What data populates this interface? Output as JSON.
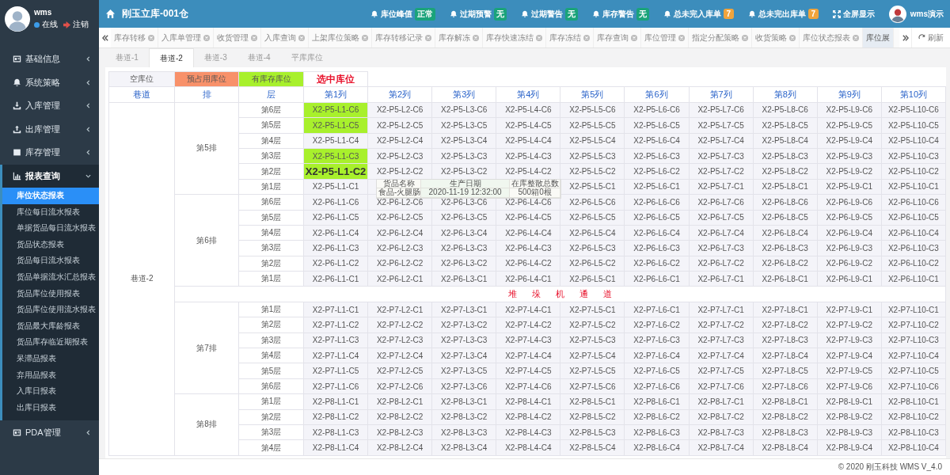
{
  "sidebar": {
    "user": {
      "name": "wms",
      "status": "在线",
      "logout": "注销"
    },
    "menu": [
      {
        "label": "基础信息",
        "expanded": false
      },
      {
        "label": "系统策略",
        "expanded": false
      },
      {
        "label": "入库管理",
        "expanded": false
      },
      {
        "label": "出库管理",
        "expanded": false
      },
      {
        "label": "库存管理",
        "expanded": false
      },
      {
        "label": "报表查询",
        "expanded": true,
        "children": [
          {
            "label": "库位状态报表",
            "selected": true
          },
          {
            "label": "库位每日流水报表",
            "selected": false
          },
          {
            "label": "单据货品每日流水报表",
            "selected": false
          },
          {
            "label": "货品状态报表",
            "selected": false
          },
          {
            "label": "货品每日流水报表",
            "selected": false
          },
          {
            "label": "货品单据流水汇总报表",
            "selected": false
          },
          {
            "label": "货品库位使用报表",
            "selected": false
          },
          {
            "label": "货品库位使用流水报表",
            "selected": false
          },
          {
            "label": "货品最大库龄报表",
            "selected": false
          },
          {
            "label": "货品库存临近期报表",
            "selected": false
          },
          {
            "label": "呆滞品报表",
            "selected": false
          },
          {
            "label": "弃用品报表",
            "selected": false
          },
          {
            "label": "入库日报表",
            "selected": false
          },
          {
            "label": "出库日报表",
            "selected": false
          }
        ]
      },
      {
        "label": "PDA管理",
        "expanded": false
      }
    ]
  },
  "header": {
    "title": "刚玉立库-001仓",
    "alerts": [
      {
        "label": "库位峰值",
        "badge": "正常",
        "color": "#1aa37a"
      },
      {
        "label": "过期预警",
        "badge": "无",
        "color": "#1aa37a"
      },
      {
        "label": "过期警告",
        "badge": "无",
        "color": "#1aa37a"
      },
      {
        "label": "库存警告",
        "badge": "无",
        "color": "#1aa37a"
      },
      {
        "label": "总未完入库单",
        "badge": "7",
        "color": "#f0a43c"
      },
      {
        "label": "总未完出库单",
        "badge": "7",
        "color": "#f0a43c"
      }
    ],
    "fullscreen": "全屏显示",
    "user": "wms演示"
  },
  "tabs": [
    {
      "label": "库存转移",
      "selected": false,
      "closable": true
    },
    {
      "label": "入库单管理",
      "selected": false,
      "closable": true
    },
    {
      "label": "收货管理",
      "selected": false,
      "closable": true
    },
    {
      "label": "入库查询",
      "selected": false,
      "closable": true
    },
    {
      "label": "上架库位策略",
      "selected": false,
      "closable": true
    },
    {
      "label": "库存转移记录",
      "selected": false,
      "closable": true
    },
    {
      "label": "库存解冻",
      "selected": false,
      "closable": true
    },
    {
      "label": "库存快速冻结",
      "selected": false,
      "closable": true
    },
    {
      "label": "库存冻结",
      "selected": false,
      "closable": true
    },
    {
      "label": "库存查询",
      "selected": false,
      "closable": true
    },
    {
      "label": "库位管理",
      "selected": false,
      "closable": true
    },
    {
      "label": "指定分配策略",
      "selected": false,
      "closable": true
    },
    {
      "label": "收货策略",
      "selected": false,
      "closable": true
    },
    {
      "label": "库位状态报表",
      "selected": false,
      "closable": true
    },
    {
      "label": "库位展",
      "selected": true,
      "closable": false
    }
  ],
  "refresh": "刷新",
  "subtabs": [
    {
      "label": "巷道-1",
      "selected": false
    },
    {
      "label": "巷道-2",
      "selected": true
    },
    {
      "label": "巷道-3",
      "selected": false
    },
    {
      "label": "巷道-4",
      "selected": false
    },
    {
      "label": "平库库位",
      "selected": false
    }
  ],
  "grid": {
    "legend": [
      {
        "label": "空库位",
        "kind": "empty"
      },
      {
        "label": "预占用库位",
        "kind": "reserved"
      },
      {
        "label": "有库存库位",
        "kind": "stocked"
      },
      {
        "label": "选中库位",
        "kind": "selected"
      }
    ],
    "columns": [
      "巷道",
      "排",
      "层",
      "第1列",
      "第2列",
      "第3列",
      "第4列",
      "第5列",
      "第6列",
      "第7列",
      "第8列",
      "第9列",
      "第10列"
    ],
    "aisle": "巷道-2",
    "blocks": [
      {
        "kind": "rack",
        "row": "第5排",
        "layers": [
          {
            "layer": "第6层",
            "cells": [
              {
                "code": "X2-P5-L1-C6",
                "stocked": true,
                "selected": false
              },
              {
                "code": "X2-P5-L2-C6",
                "stocked": false,
                "selected": false
              },
              {
                "code": "X2-P5-L3-C6",
                "stocked": false,
                "selected": false
              },
              {
                "code": "X2-P5-L4-C6",
                "stocked": false,
                "selected": false
              },
              {
                "code": "X2-P5-L5-C6",
                "stocked": false,
                "selected": false
              },
              {
                "code": "X2-P5-L6-C6",
                "stocked": false,
                "selected": false
              },
              {
                "code": "X2-P5-L7-C6",
                "stocked": false,
                "selected": false
              },
              {
                "code": "X2-P5-L8-C6",
                "stocked": false,
                "selected": false
              },
              {
                "code": "X2-P5-L9-C6",
                "stocked": false,
                "selected": false
              },
              {
                "code": "X2-P5-L10-C6",
                "stocked": false,
                "selected": false
              }
            ]
          },
          {
            "layer": "第5层",
            "cells": [
              {
                "code": "X2-P5-L1-C5",
                "stocked": true,
                "selected": false
              },
              {
                "code": "X2-P5-L2-C5",
                "stocked": false,
                "selected": false
              },
              {
                "code": "X2-P5-L3-C5",
                "stocked": false,
                "selected": false
              },
              {
                "code": "X2-P5-L4-C5",
                "stocked": false,
                "selected": false
              },
              {
                "code": "X2-P5-L5-C5",
                "stocked": false,
                "selected": false
              },
              {
                "code": "X2-P5-L6-C5",
                "stocked": false,
                "selected": false
              },
              {
                "code": "X2-P5-L7-C5",
                "stocked": false,
                "selected": false
              },
              {
                "code": "X2-P5-L8-C5",
                "stocked": false,
                "selected": false
              },
              {
                "code": "X2-P5-L9-C5",
                "stocked": false,
                "selected": false
              },
              {
                "code": "X2-P5-L10-C5",
                "stocked": false,
                "selected": false
              }
            ]
          },
          {
            "layer": "第4层",
            "cells": [
              {
                "code": "X2-P5-L1-C4",
                "stocked": false,
                "selected": false
              },
              {
                "code": "X2-P5-L2-C4",
                "stocked": false,
                "selected": false
              },
              {
                "code": "X2-P5-L3-C4",
                "stocked": false,
                "selected": false
              },
              {
                "code": "X2-P5-L4-C4",
                "stocked": false,
                "selected": false
              },
              {
                "code": "X2-P5-L5-C4",
                "stocked": false,
                "selected": false
              },
              {
                "code": "X2-P5-L6-C4",
                "stocked": false,
                "selected": false
              },
              {
                "code": "X2-P5-L7-C4",
                "stocked": false,
                "selected": false
              },
              {
                "code": "X2-P5-L8-C4",
                "stocked": false,
                "selected": false
              },
              {
                "code": "X2-P5-L9-C4",
                "stocked": false,
                "selected": false
              },
              {
                "code": "X2-P5-L10-C4",
                "stocked": false,
                "selected": false
              }
            ]
          },
          {
            "layer": "第3层",
            "cells": [
              {
                "code": "X2-P5-L1-C3",
                "stocked": true,
                "selected": false
              },
              {
                "code": "X2-P5-L2-C3",
                "stocked": false,
                "selected": false
              },
              {
                "code": "X2-P5-L3-C3",
                "stocked": false,
                "selected": false
              },
              {
                "code": "X2-P5-L4-C3",
                "stocked": false,
                "selected": false
              },
              {
                "code": "X2-P5-L5-C3",
                "stocked": false,
                "selected": false
              },
              {
                "code": "X2-P5-L6-C3",
                "stocked": false,
                "selected": false
              },
              {
                "code": "X2-P5-L7-C3",
                "stocked": false,
                "selected": false
              },
              {
                "code": "X2-P5-L8-C3",
                "stocked": false,
                "selected": false
              },
              {
                "code": "X2-P5-L9-C3",
                "stocked": false,
                "selected": false
              },
              {
                "code": "X2-P5-L10-C3",
                "stocked": false,
                "selected": false
              }
            ]
          },
          {
            "layer": "第2层",
            "cells": [
              {
                "code": "X2-P5-L1-C2",
                "stocked": true,
                "selected": true
              },
              {
                "code": "X2-P5-L2-C2",
                "stocked": false,
                "selected": false
              },
              {
                "code": "X2-P5-L3-C2",
                "stocked": false,
                "selected": false
              },
              {
                "code": "X2-P5-L4-C2",
                "stocked": false,
                "selected": false
              },
              {
                "code": "X2-P5-L5-C2",
                "stocked": false,
                "selected": false
              },
              {
                "code": "X2-P5-L6-C2",
                "stocked": false,
                "selected": false
              },
              {
                "code": "X2-P5-L7-C2",
                "stocked": false,
                "selected": false
              },
              {
                "code": "X2-P5-L8-C2",
                "stocked": false,
                "selected": false
              },
              {
                "code": "X2-P5-L9-C2",
                "stocked": false,
                "selected": false
              },
              {
                "code": "X2-P5-L10-C2",
                "stocked": false,
                "selected": false
              }
            ]
          },
          {
            "layer": "第1层",
            "tooltip": {
              "headers": [
                "货品名称",
                "生产日期",
                "在库整散总数"
              ],
              "values": [
                "食品-火腿肠",
                "2020-11-19 12:32:00",
                "500箱0根"
              ]
            },
            "cells": [
              {
                "code": "X2-P5-L1-C1",
                "stocked": false,
                "selected": false
              },
              {},
              {},
              {},
              {
                "code": "X2-P5-L5-C1",
                "stocked": false,
                "selected": false
              },
              {
                "code": "X2-P5-L6-C1",
                "stocked": false,
                "selected": false
              },
              {
                "code": "X2-P5-L7-C1",
                "stocked": false,
                "selected": false
              },
              {
                "code": "X2-P5-L8-C1",
                "stocked": false,
                "selected": false
              },
              {
                "code": "X2-P5-L9-C1",
                "stocked": false,
                "selected": false
              },
              {
                "code": "X2-P5-L10-C1",
                "stocked": false,
                "selected": false
              }
            ]
          }
        ]
      },
      {
        "kind": "rack",
        "row": "第6排",
        "layers": [
          {
            "layer": "第6层",
            "cells": [
              {
                "code": "X2-P6-L1-C6",
                "stocked": false,
                "selected": false
              },
              {
                "code": "X2-P6-L2-C6",
                "stocked": false,
                "selected": false
              },
              {
                "code": "X2-P6-L3-C6",
                "stocked": false,
                "selected": false
              },
              {
                "code": "X2-P6-L4-C6",
                "stocked": false,
                "selected": false
              },
              {
                "code": "X2-P6-L5-C6",
                "stocked": false,
                "selected": false
              },
              {
                "code": "X2-P6-L6-C6",
                "stocked": false,
                "selected": false
              },
              {
                "code": "X2-P6-L7-C6",
                "stocked": false,
                "selected": false
              },
              {
                "code": "X2-P6-L8-C6",
                "stocked": false,
                "selected": false
              },
              {
                "code": "X2-P6-L9-C6",
                "stocked": false,
                "selected": false
              },
              {
                "code": "X2-P6-L10-C6",
                "stocked": false,
                "selected": false
              }
            ]
          },
          {
            "layer": "第5层",
            "cells": [
              {
                "code": "X2-P6-L1-C5",
                "stocked": false,
                "selected": false
              },
              {
                "code": "X2-P6-L2-C5",
                "stocked": false,
                "selected": false
              },
              {
                "code": "X2-P6-L3-C5",
                "stocked": false,
                "selected": false
              },
              {
                "code": "X2-P6-L4-C5",
                "stocked": false,
                "selected": false
              },
              {
                "code": "X2-P6-L5-C5",
                "stocked": false,
                "selected": false
              },
              {
                "code": "X2-P6-L6-C5",
                "stocked": false,
                "selected": false
              },
              {
                "code": "X2-P6-L7-C5",
                "stocked": false,
                "selected": false
              },
              {
                "code": "X2-P6-L8-C5",
                "stocked": false,
                "selected": false
              },
              {
                "code": "X2-P6-L9-C5",
                "stocked": false,
                "selected": false
              },
              {
                "code": "X2-P6-L10-C5",
                "stocked": false,
                "selected": false
              }
            ]
          },
          {
            "layer": "第4层",
            "cells": [
              {
                "code": "X2-P6-L1-C4",
                "stocked": false,
                "selected": false
              },
              {
                "code": "X2-P6-L2-C4",
                "stocked": false,
                "selected": false
              },
              {
                "code": "X2-P6-L3-C4",
                "stocked": false,
                "selected": false
              },
              {
                "code": "X2-P6-L4-C4",
                "stocked": false,
                "selected": false
              },
              {
                "code": "X2-P6-L5-C4",
                "stocked": false,
                "selected": false
              },
              {
                "code": "X2-P6-L6-C4",
                "stocked": false,
                "selected": false
              },
              {
                "code": "X2-P6-L7-C4",
                "stocked": false,
                "selected": false
              },
              {
                "code": "X2-P6-L8-C4",
                "stocked": false,
                "selected": false
              },
              {
                "code": "X2-P6-L9-C4",
                "stocked": false,
                "selected": false
              },
              {
                "code": "X2-P6-L10-C4",
                "stocked": false,
                "selected": false
              }
            ]
          },
          {
            "layer": "第3层",
            "cells": [
              {
                "code": "X2-P6-L1-C3",
                "stocked": false,
                "selected": false
              },
              {
                "code": "X2-P6-L2-C3",
                "stocked": false,
                "selected": false
              },
              {
                "code": "X2-P6-L3-C3",
                "stocked": false,
                "selected": false
              },
              {
                "code": "X2-P6-L4-C3",
                "stocked": false,
                "selected": false
              },
              {
                "code": "X2-P6-L5-C3",
                "stocked": false,
                "selected": false
              },
              {
                "code": "X2-P6-L6-C3",
                "stocked": false,
                "selected": false
              },
              {
                "code": "X2-P6-L7-C3",
                "stocked": false,
                "selected": false
              },
              {
                "code": "X2-P6-L8-C3",
                "stocked": false,
                "selected": false
              },
              {
                "code": "X2-P6-L9-C3",
                "stocked": false,
                "selected": false
              },
              {
                "code": "X2-P6-L10-C3",
                "stocked": false,
                "selected": false
              }
            ]
          },
          {
            "layer": "第2层",
            "cells": [
              {
                "code": "X2-P6-L1-C2",
                "stocked": false,
                "selected": false
              },
              {
                "code": "X2-P6-L2-C2",
                "stocked": false,
                "selected": false
              },
              {
                "code": "X2-P6-L3-C2",
                "stocked": false,
                "selected": false
              },
              {
                "code": "X2-P6-L4-C2",
                "stocked": false,
                "selected": false
              },
              {
                "code": "X2-P6-L5-C2",
                "stocked": false,
                "selected": false
              },
              {
                "code": "X2-P6-L6-C2",
                "stocked": false,
                "selected": false
              },
              {
                "code": "X2-P6-L7-C2",
                "stocked": false,
                "selected": false
              },
              {
                "code": "X2-P6-L8-C2",
                "stocked": false,
                "selected": false
              },
              {
                "code": "X2-P6-L9-C2",
                "stocked": false,
                "selected": false
              },
              {
                "code": "X2-P6-L10-C2",
                "stocked": false,
                "selected": false
              }
            ]
          },
          {
            "layer": "第1层",
            "cells": [
              {
                "code": "X2-P6-L1-C1",
                "stocked": false,
                "selected": false
              },
              {
                "code": "X2-P6-L2-C1",
                "stocked": false,
                "selected": false
              },
              {
                "code": "X2-P6-L3-C1",
                "stocked": false,
                "selected": false
              },
              {
                "code": "X2-P6-L4-C1",
                "stocked": false,
                "selected": false
              },
              {
                "code": "X2-P6-L5-C1",
                "stocked": false,
                "selected": false
              },
              {
                "code": "X2-P6-L6-C1",
                "stocked": false,
                "selected": false
              },
              {
                "code": "X2-P6-L7-C1",
                "stocked": false,
                "selected": false
              },
              {
                "code": "X2-P6-L8-C1",
                "stocked": false,
                "selected": false
              },
              {
                "code": "X2-P6-L9-C1",
                "stocked": false,
                "selected": false
              },
              {
                "code": "X2-P6-L10-C1",
                "stocked": false,
                "selected": false
              }
            ]
          }
        ]
      },
      {
        "kind": "passage",
        "label": "堆 垛 机 通 道"
      },
      {
        "kind": "rack",
        "row": "第7排",
        "layers": [
          {
            "layer": "第1层",
            "cells": [
              {
                "code": "X2-P7-L1-C1",
                "stocked": false,
                "selected": false
              },
              {
                "code": "X2-P7-L2-C1",
                "stocked": false,
                "selected": false
              },
              {
                "code": "X2-P7-L3-C1",
                "stocked": false,
                "selected": false
              },
              {
                "code": "X2-P7-L4-C1",
                "stocked": false,
                "selected": false
              },
              {
                "code": "X2-P7-L5-C1",
                "stocked": false,
                "selected": false
              },
              {
                "code": "X2-P7-L6-C1",
                "stocked": false,
                "selected": false
              },
              {
                "code": "X2-P7-L7-C1",
                "stocked": false,
                "selected": false
              },
              {
                "code": "X2-P7-L8-C1",
                "stocked": false,
                "selected": false
              },
              {
                "code": "X2-P7-L9-C1",
                "stocked": false,
                "selected": false
              },
              {
                "code": "X2-P7-L10-C1",
                "stocked": false,
                "selected": false
              }
            ]
          },
          {
            "layer": "第2层",
            "cells": [
              {
                "code": "X2-P7-L1-C2",
                "stocked": false,
                "selected": false
              },
              {
                "code": "X2-P7-L2-C2",
                "stocked": false,
                "selected": false
              },
              {
                "code": "X2-P7-L3-C2",
                "stocked": false,
                "selected": false
              },
              {
                "code": "X2-P7-L4-C2",
                "stocked": false,
                "selected": false
              },
              {
                "code": "X2-P7-L5-C2",
                "stocked": false,
                "selected": false
              },
              {
                "code": "X2-P7-L6-C2",
                "stocked": false,
                "selected": false
              },
              {
                "code": "X2-P7-L7-C2",
                "stocked": false,
                "selected": false
              },
              {
                "code": "X2-P7-L8-C2",
                "stocked": false,
                "selected": false
              },
              {
                "code": "X2-P7-L9-C2",
                "stocked": false,
                "selected": false
              },
              {
                "code": "X2-P7-L10-C2",
                "stocked": false,
                "selected": false
              }
            ]
          },
          {
            "layer": "第3层",
            "cells": [
              {
                "code": "X2-P7-L1-C3",
                "stocked": false,
                "selected": false
              },
              {
                "code": "X2-P7-L2-C3",
                "stocked": false,
                "selected": false
              },
              {
                "code": "X2-P7-L3-C3",
                "stocked": false,
                "selected": false
              },
              {
                "code": "X2-P7-L4-C3",
                "stocked": false,
                "selected": false
              },
              {
                "code": "X2-P7-L5-C3",
                "stocked": false,
                "selected": false
              },
              {
                "code": "X2-P7-L6-C3",
                "stocked": false,
                "selected": false
              },
              {
                "code": "X2-P7-L7-C3",
                "stocked": false,
                "selected": false
              },
              {
                "code": "X2-P7-L8-C3",
                "stocked": false,
                "selected": false
              },
              {
                "code": "X2-P7-L9-C3",
                "stocked": false,
                "selected": false
              },
              {
                "code": "X2-P7-L10-C3",
                "stocked": false,
                "selected": false
              }
            ]
          },
          {
            "layer": "第4层",
            "cells": [
              {
                "code": "X2-P7-L1-C4",
                "stocked": false,
                "selected": false
              },
              {
                "code": "X2-P7-L2-C4",
                "stocked": false,
                "selected": false
              },
              {
                "code": "X2-P7-L3-C4",
                "stocked": false,
                "selected": false
              },
              {
                "code": "X2-P7-L4-C4",
                "stocked": false,
                "selected": false
              },
              {
                "code": "X2-P7-L5-C4",
                "stocked": false,
                "selected": false
              },
              {
                "code": "X2-P7-L6-C4",
                "stocked": false,
                "selected": false
              },
              {
                "code": "X2-P7-L7-C4",
                "stocked": false,
                "selected": false
              },
              {
                "code": "X2-P7-L8-C4",
                "stocked": false,
                "selected": false
              },
              {
                "code": "X2-P7-L9-C4",
                "stocked": false,
                "selected": false
              },
              {
                "code": "X2-P7-L10-C4",
                "stocked": false,
                "selected": false
              }
            ]
          },
          {
            "layer": "第5层",
            "cells": [
              {
                "code": "X2-P7-L1-C5",
                "stocked": false,
                "selected": false
              },
              {
                "code": "X2-P7-L2-C5",
                "stocked": false,
                "selected": false
              },
              {
                "code": "X2-P7-L3-C5",
                "stocked": false,
                "selected": false
              },
              {
                "code": "X2-P7-L4-C5",
                "stocked": false,
                "selected": false
              },
              {
                "code": "X2-P7-L5-C5",
                "stocked": false,
                "selected": false
              },
              {
                "code": "X2-P7-L6-C5",
                "stocked": false,
                "selected": false
              },
              {
                "code": "X2-P7-L7-C5",
                "stocked": false,
                "selected": false
              },
              {
                "code": "X2-P7-L8-C5",
                "stocked": false,
                "selected": false
              },
              {
                "code": "X2-P7-L9-C5",
                "stocked": false,
                "selected": false
              },
              {
                "code": "X2-P7-L10-C5",
                "stocked": false,
                "selected": false
              }
            ]
          },
          {
            "layer": "第6层",
            "cells": [
              {
                "code": "X2-P7-L1-C6",
                "stocked": false,
                "selected": false
              },
              {
                "code": "X2-P7-L2-C6",
                "stocked": false,
                "selected": false
              },
              {
                "code": "X2-P7-L3-C6",
                "stocked": false,
                "selected": false
              },
              {
                "code": "X2-P7-L4-C6",
                "stocked": false,
                "selected": false
              },
              {
                "code": "X2-P7-L5-C6",
                "stocked": false,
                "selected": false
              },
              {
                "code": "X2-P7-L6-C6",
                "stocked": false,
                "selected": false
              },
              {
                "code": "X2-P7-L7-C6",
                "stocked": false,
                "selected": false
              },
              {
                "code": "X2-P7-L8-C6",
                "stocked": false,
                "selected": false
              },
              {
                "code": "X2-P7-L9-C6",
                "stocked": false,
                "selected": false
              },
              {
                "code": "X2-P7-L10-C6",
                "stocked": false,
                "selected": false
              }
            ]
          }
        ]
      },
      {
        "kind": "rack",
        "row": "第8排",
        "layers": [
          {
            "layer": "第1层",
            "cells": [
              {
                "code": "X2-P8-L1-C1",
                "stocked": false,
                "selected": false
              },
              {
                "code": "X2-P8-L2-C1",
                "stocked": false,
                "selected": false
              },
              {
                "code": "X2-P8-L3-C1",
                "stocked": false,
                "selected": false
              },
              {
                "code": "X2-P8-L4-C1",
                "stocked": false,
                "selected": false
              },
              {
                "code": "X2-P8-L5-C1",
                "stocked": false,
                "selected": false
              },
              {
                "code": "X2-P8-L6-C1",
                "stocked": false,
                "selected": false
              },
              {
                "code": "X2-P8-L7-C1",
                "stocked": false,
                "selected": false
              },
              {
                "code": "X2-P8-L8-C1",
                "stocked": false,
                "selected": false
              },
              {
                "code": "X2-P8-L9-C1",
                "stocked": false,
                "selected": false
              },
              {
                "code": "X2-P8-L10-C1",
                "stocked": false,
                "selected": false
              }
            ]
          },
          {
            "layer": "第2层",
            "cells": [
              {
                "code": "X2-P8-L1-C2",
                "stocked": false,
                "selected": false
              },
              {
                "code": "X2-P8-L2-C2",
                "stocked": false,
                "selected": false
              },
              {
                "code": "X2-P8-L3-C2",
                "stocked": false,
                "selected": false
              },
              {
                "code": "X2-P8-L4-C2",
                "stocked": false,
                "selected": false
              },
              {
                "code": "X2-P8-L5-C2",
                "stocked": false,
                "selected": false
              },
              {
                "code": "X2-P8-L6-C2",
                "stocked": false,
                "selected": false
              },
              {
                "code": "X2-P8-L7-C2",
                "stocked": false,
                "selected": false
              },
              {
                "code": "X2-P8-L8-C2",
                "stocked": false,
                "selected": false
              },
              {
                "code": "X2-P8-L9-C2",
                "stocked": false,
                "selected": false
              },
              {
                "code": "X2-P8-L10-C2",
                "stocked": false,
                "selected": false
              }
            ]
          },
          {
            "layer": "第3层",
            "cells": [
              {
                "code": "X2-P8-L1-C3",
                "stocked": false,
                "selected": false
              },
              {
                "code": "X2-P8-L2-C3",
                "stocked": false,
                "selected": false
              },
              {
                "code": "X2-P8-L3-C3",
                "stocked": false,
                "selected": false
              },
              {
                "code": "X2-P8-L4-C3",
                "stocked": false,
                "selected": false
              },
              {
                "code": "X2-P8-L5-C3",
                "stocked": false,
                "selected": false
              },
              {
                "code": "X2-P8-L6-C3",
                "stocked": false,
                "selected": false
              },
              {
                "code": "X2-P8-L7-C3",
                "stocked": false,
                "selected": false
              },
              {
                "code": "X2-P8-L8-C3",
                "stocked": false,
                "selected": false
              },
              {
                "code": "X2-P8-L9-C3",
                "stocked": false,
                "selected": false
              },
              {
                "code": "X2-P8-L10-C3",
                "stocked": false,
                "selected": false
              }
            ]
          },
          {
            "layer": "第4层",
            "cells": [
              {
                "code": "X2-P8-L1-C4",
                "stocked": false,
                "selected": false
              },
              {
                "code": "X2-P8-L2-C4",
                "stocked": false,
                "selected": false
              },
              {
                "code": "X2-P8-L3-C4",
                "stocked": false,
                "selected": false
              },
              {
                "code": "X2-P8-L4-C4",
                "stocked": false,
                "selected": false
              },
              {
                "code": "X2-P8-L5-C4",
                "stocked": false,
                "selected": false
              },
              {
                "code": "X2-P8-L6-C4",
                "stocked": false,
                "selected": false
              },
              {
                "code": "X2-P8-L7-C4",
                "stocked": false,
                "selected": false
              },
              {
                "code": "X2-P8-L8-C4",
                "stocked": false,
                "selected": false
              },
              {
                "code": "X2-P8-L9-C4",
                "stocked": false,
                "selected": false
              },
              {
                "code": "X2-P8-L10-C4",
                "stocked": false,
                "selected": false
              }
            ]
          }
        ]
      }
    ]
  },
  "footer": "© 2020 刚玉科技 WMS V_4.0"
}
